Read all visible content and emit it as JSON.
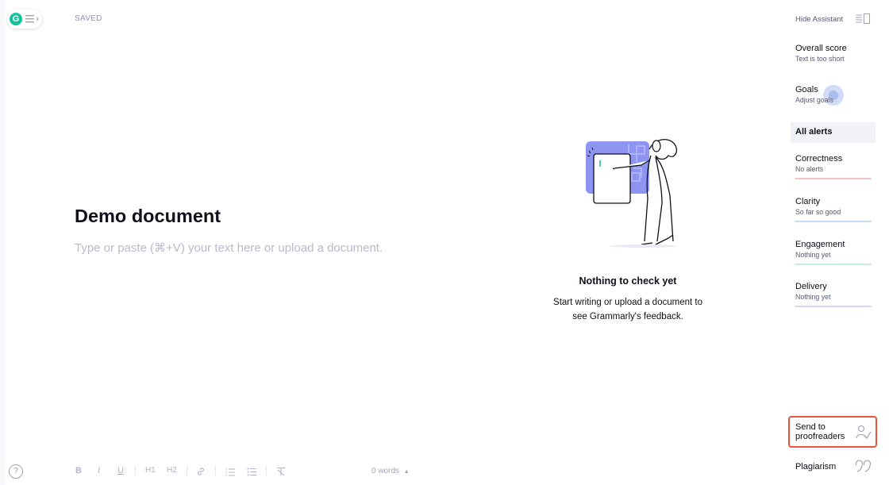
{
  "header": {
    "logo_letter": "G",
    "status": "SAVED"
  },
  "document": {
    "title": "Demo document",
    "placeholder": "Type or paste (⌘+V) your text here or upload a document."
  },
  "empty_state": {
    "title": "Nothing to check yet",
    "text": "Start writing or upload a document to see Grammarly's feedback."
  },
  "toolbar": {
    "help": "?",
    "bold": "B",
    "italic": "I",
    "underline": "U",
    "h1": "H1",
    "h2": "H2",
    "word_count": "0 words",
    "word_count_caret": "▲"
  },
  "sidebar": {
    "hide_assistant": "Hide Assistant",
    "overall_score": {
      "title": "Overall score",
      "sub": "Text is too short"
    },
    "goals": {
      "title": "Goals",
      "sub": "Adjust goals"
    },
    "all_alerts": "All alerts",
    "categories": [
      {
        "title": "Correctness",
        "sub": "No alerts",
        "color": "#f3c3c5"
      },
      {
        "title": "Clarity",
        "sub": "So far so good",
        "color": "#c4dcf6"
      },
      {
        "title": "Engagement",
        "sub": "Nothing yet",
        "color": "#c5ecd9"
      },
      {
        "title": "Delivery",
        "sub": "Nothing yet",
        "color": "#dcd3f6"
      }
    ],
    "send_to_proofreaders": "Send to proofreaders",
    "plagiarism": "Plagiarism"
  },
  "colors": {
    "brand_green": "#15c39a",
    "accent_purple": "#8e94f2",
    "highlight_border": "#e8563a"
  }
}
